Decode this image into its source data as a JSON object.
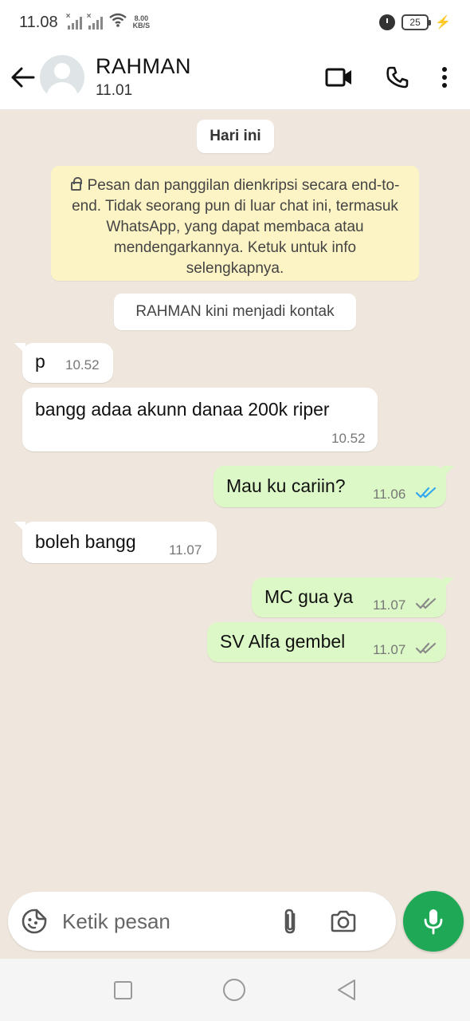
{
  "status_bar": {
    "time": "11.08",
    "net_speed_value": "8.00",
    "net_speed_unit": "KB/S",
    "battery": "25"
  },
  "header": {
    "contact_name": "RAHMAN",
    "last_seen": "11.01"
  },
  "chat": {
    "day_label": "Hari ini",
    "encryption_notice": "Pesan dan panggilan dienkripsi secara end-to-end. Tidak seorang pun di luar chat ini, termasuk WhatsApp, yang dapat membaca atau mendengarkannya. Ketuk untuk info selengkapnya.",
    "contact_added_notice": "RAHMAN kini menjadi kontak",
    "messages": [
      {
        "direction": "in",
        "text": "p",
        "time": "10.52"
      },
      {
        "direction": "in",
        "text": "bangg adaa akunn danaa 200k riper",
        "time": "10.52"
      },
      {
        "direction": "out",
        "text": "Mau ku cariin?",
        "time": "11.06",
        "status": "read"
      },
      {
        "direction": "in",
        "text": "boleh bangg",
        "time": "11.07"
      },
      {
        "direction": "out",
        "text": "MC gua ya",
        "time": "11.07",
        "status": "delivered"
      },
      {
        "direction": "out",
        "text": "SV Alfa gembel",
        "time": "11.07",
        "status": "delivered"
      }
    ]
  },
  "composer": {
    "placeholder": "Ketik pesan"
  },
  "colors": {
    "chat_background": "#efe7dd",
    "outgoing_bubble": "#dcf8c6",
    "incoming_bubble": "#ffffff",
    "system_notice": "#fdf4c5",
    "read_ticks": "#34a7f0",
    "delivered_ticks": "#8a8a8a",
    "mic_button": "#1fa855"
  },
  "icons": {
    "back": "arrow-left-icon",
    "video_call": "video-camera-icon",
    "voice_call": "phone-icon",
    "menu": "more-vertical-icon",
    "emoji": "emoji-icon",
    "attach": "paperclip-icon",
    "camera": "camera-icon",
    "mic": "microphone-icon"
  }
}
